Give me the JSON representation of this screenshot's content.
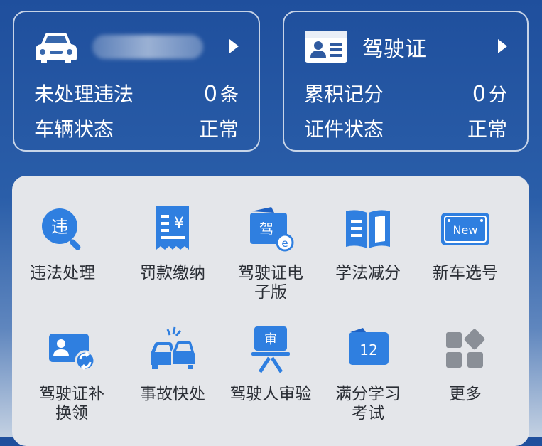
{
  "vehicle_card": {
    "unprocessed_label": "未处理违法",
    "unprocessed_count": "0",
    "unprocessed_unit": "条",
    "status_label": "车辆状态",
    "status_value": "正常"
  },
  "license_card": {
    "title": "驾驶证",
    "points_label": "累积记分",
    "points_value": "0",
    "points_unit": "分",
    "status_label": "证件状态",
    "status_value": "正常"
  },
  "services": [
    {
      "label": "违法处理",
      "icon": "violation-search-icon",
      "icon_text": "违"
    },
    {
      "label": "罚款缴纳",
      "icon": "fine-receipt-icon",
      "icon_text": "¥"
    },
    {
      "label": "驾驶证电子版",
      "icon": "e-license-icon",
      "icon_text": "驾"
    },
    {
      "label": "学法减分",
      "icon": "open-book-icon"
    },
    {
      "label": "新车选号",
      "icon": "new-plate-icon",
      "icon_text": "New"
    },
    {
      "label": "驾驶证补换领",
      "icon": "license-renew-icon"
    },
    {
      "label": "事故快处",
      "icon": "car-accident-icon"
    },
    {
      "label": "驾驶人审验",
      "icon": "driver-review-icon",
      "icon_text": "审"
    },
    {
      "label": "满分学习考试",
      "icon": "calendar-exam-icon",
      "icon_text": "12"
    },
    {
      "label": "更多",
      "icon": "more-grid-icon"
    }
  ],
  "colors": {
    "header_bg": "#2a5ea9",
    "icon_blue": "#2f7fe0",
    "panel_bg": "#e4e6ea",
    "label_text": "#2b2f36"
  }
}
